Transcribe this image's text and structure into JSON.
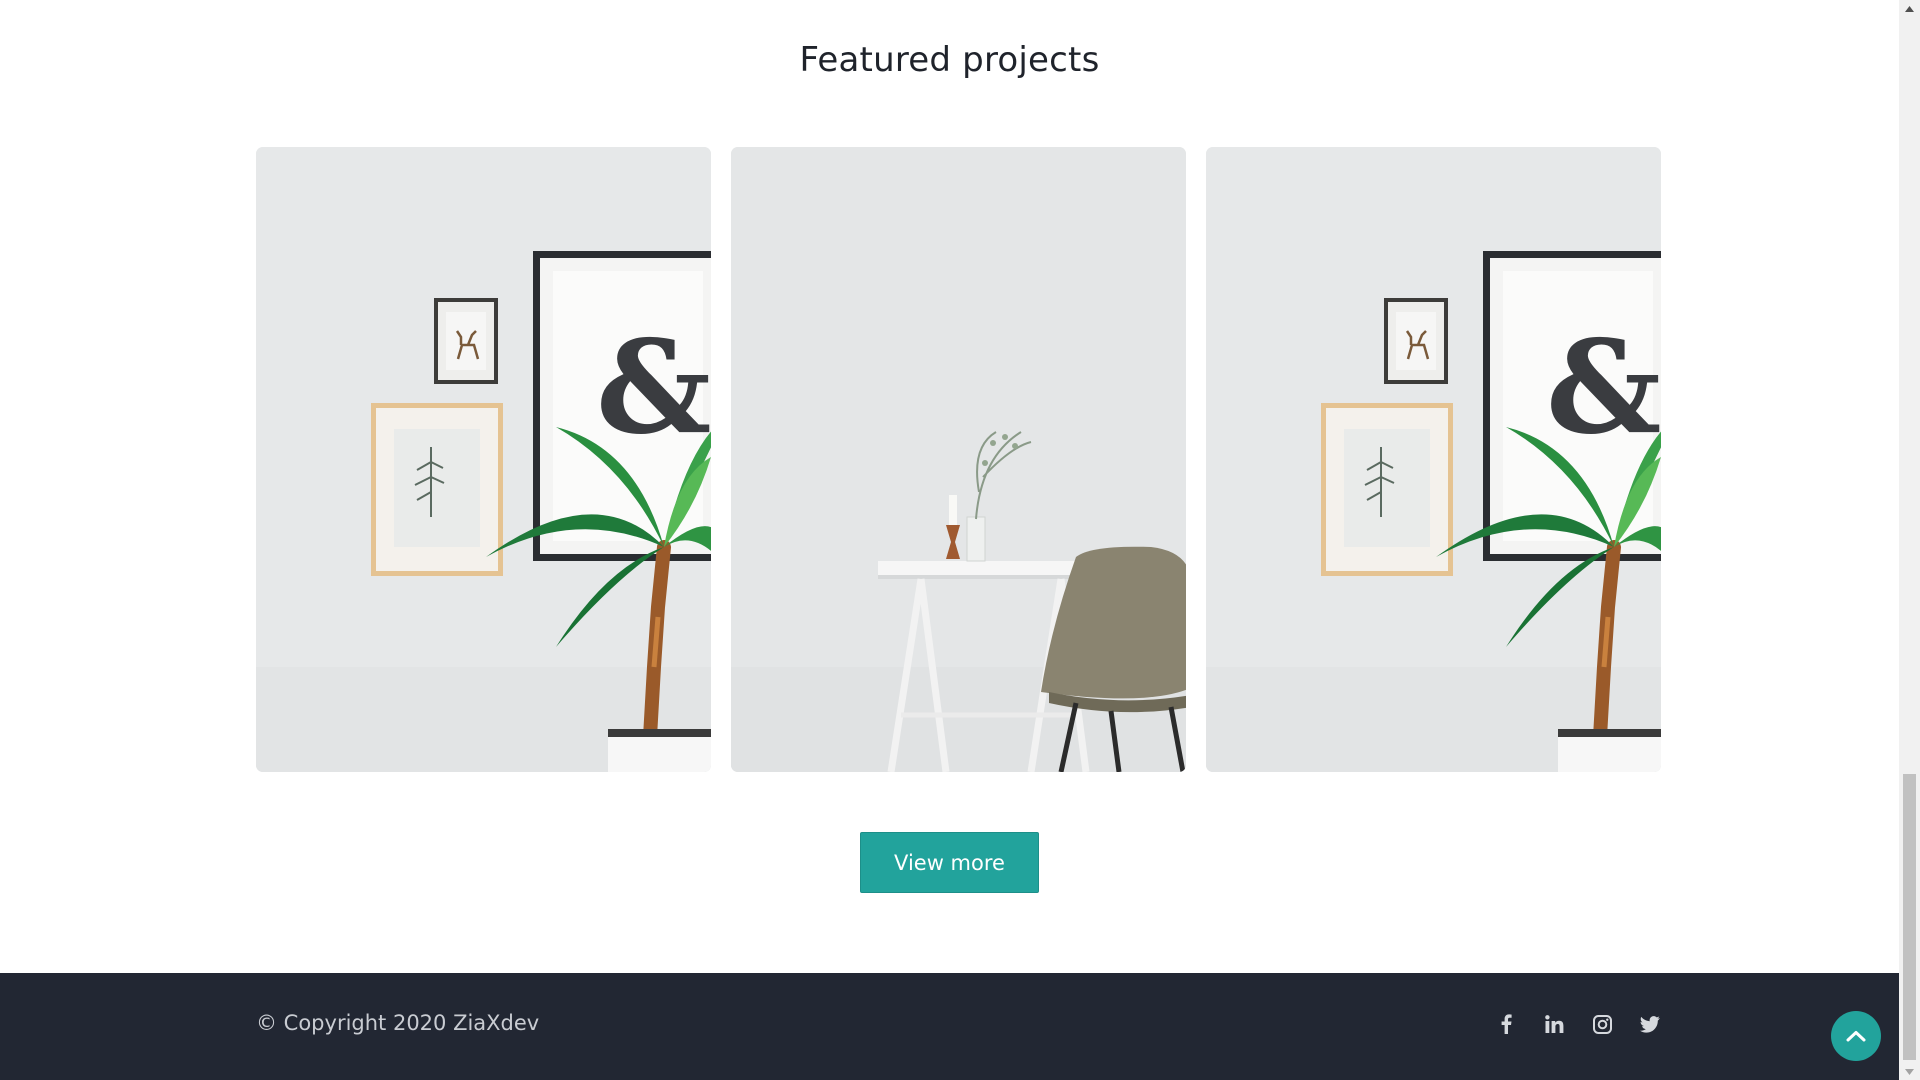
{
  "section": {
    "title": "Featured projects"
  },
  "gallery": {
    "items": [
      {
        "name": "project-card-1",
        "subject": "plant and framed prints"
      },
      {
        "name": "project-card-2",
        "subject": "desk and chair"
      },
      {
        "name": "project-card-3",
        "subject": "plant and framed prints"
      }
    ]
  },
  "actions": {
    "view_more_label": "View more"
  },
  "footer": {
    "copyright": "© Copyright 2020 ZiaXdev",
    "social_icons": [
      "facebook-icon",
      "linkedin-icon",
      "instagram-icon",
      "twitter-icon"
    ]
  },
  "colors": {
    "accent": "#22a39c",
    "footer_bg": "#222733",
    "title_text": "#1f232b",
    "footer_text": "#c9ccd2"
  }
}
